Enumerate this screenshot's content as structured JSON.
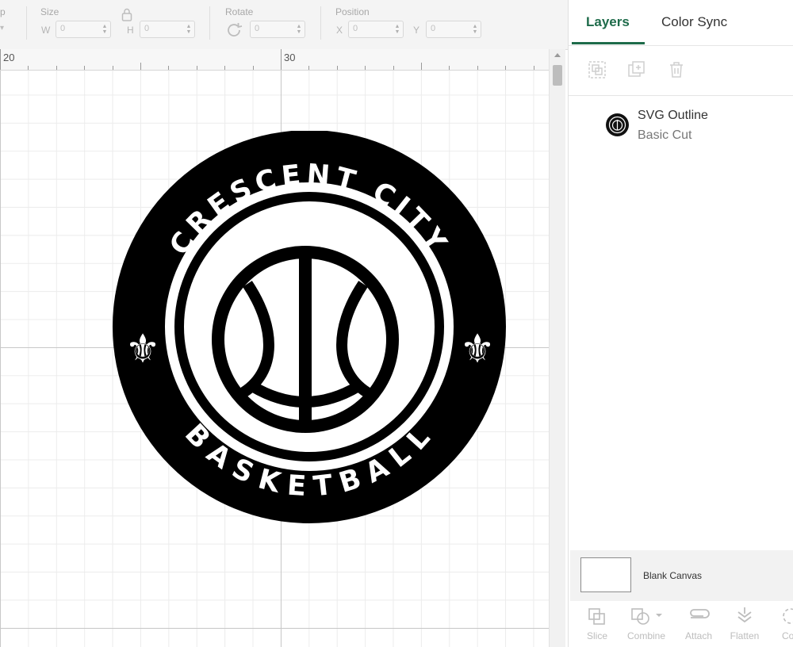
{
  "toolbar": {
    "partial_label": "p",
    "size_label": "Size",
    "w_letter": "W",
    "w_value": "0",
    "h_letter": "H",
    "h_value": "0",
    "rotate_label": "Rotate",
    "rotate_value": "0",
    "position_label": "Position",
    "x_letter": "X",
    "x_value": "0",
    "y_letter": "Y",
    "y_value": "0",
    "spin_up": "▲",
    "spin_down": "▼"
  },
  "ruler": {
    "label_a": "20",
    "label_b": "30"
  },
  "logo": {
    "top_text": "CRESCENT CITY",
    "bottom_text": "BASKETBALL",
    "fleur_left": "⚜",
    "fleur_right": "⚜",
    "color": "#000000"
  },
  "panel": {
    "tabs": [
      {
        "label": "Layers",
        "active": true
      },
      {
        "label": "Color Sync",
        "active": false
      }
    ],
    "layer_tools": [
      "group-icon",
      "duplicate-icon",
      "delete-icon"
    ],
    "layers": [
      {
        "name": "SVG Outline",
        "type": "Basic Cut"
      }
    ],
    "blank_canvas_label": "Blank Canvas",
    "bottom_tools": [
      {
        "label": "Slice",
        "icon": "slice-icon"
      },
      {
        "label": "Combine",
        "icon": "combine-icon"
      },
      {
        "label": "Attach",
        "icon": "attach-icon"
      },
      {
        "label": "Flatten",
        "icon": "flatten-icon"
      },
      {
        "label": "Con",
        "icon": "contour-icon"
      }
    ],
    "accent_color": "#1e6b4a"
  }
}
